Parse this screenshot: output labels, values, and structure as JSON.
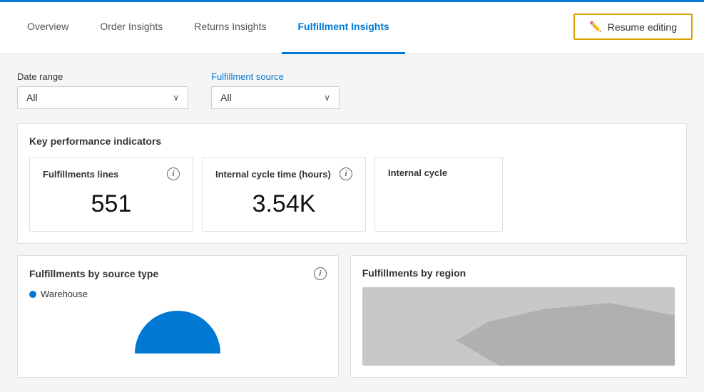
{
  "nav": {
    "tabs": [
      {
        "id": "overview",
        "label": "Overview",
        "active": false
      },
      {
        "id": "order-insights",
        "label": "Order Insights",
        "active": false
      },
      {
        "id": "returns-insights",
        "label": "Returns Insights",
        "active": false
      },
      {
        "id": "fulfillment-insights",
        "label": "Fulfillment Insights",
        "active": true
      }
    ],
    "resume_editing_label": "Resume editing"
  },
  "filters": {
    "date_range": {
      "label": "Date range",
      "value": "All"
    },
    "fulfillment_source": {
      "label": "Fulfillment source",
      "value": "All"
    }
  },
  "kpi": {
    "section_title": "Key performance indicators",
    "cards": [
      {
        "title": "Fulfillments lines",
        "value": "551"
      },
      {
        "title": "Internal cycle time (hours)",
        "value": "3.54K"
      },
      {
        "title": "Internal cycle",
        "value": ""
      }
    ]
  },
  "charts": {
    "by_source": {
      "title": "Fulfillments by source type",
      "legend": [
        {
          "label": "Warehouse",
          "color": "#0078d4"
        }
      ]
    },
    "by_region": {
      "title": "Fulfillments by region"
    }
  }
}
